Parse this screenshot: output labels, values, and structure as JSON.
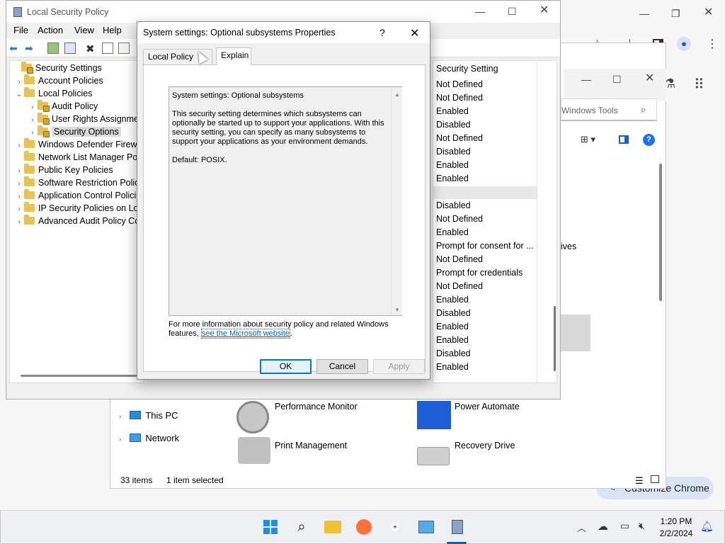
{
  "chrome": {
    "customize_label": "Customize Chrome"
  },
  "explorer": {
    "search_placeholder": "Windows Tools",
    "nav": [
      {
        "label": "This PC",
        "icon": "computer-icon"
      },
      {
        "label": "Network",
        "icon": "network-icon"
      }
    ],
    "items": [
      {
        "label": "Performance Monitor",
        "icon": "gauge-icon"
      },
      {
        "label": "Power Automate",
        "icon": "power-automate-icon"
      },
      {
        "label": "Print Management",
        "icon": "printer-icon"
      },
      {
        "label": "Recovery Drive",
        "icon": "drive-icon"
      }
    ],
    "partial_label": "ives",
    "status": {
      "count": "33 items",
      "selected": "1 item selected"
    }
  },
  "lsp": {
    "title": "Local Security Policy",
    "menu": [
      "File",
      "Action",
      "View",
      "Help"
    ],
    "tree": [
      {
        "label": "Security Settings",
        "level": 0,
        "chev": ""
      },
      {
        "label": "Account Policies",
        "level": 1,
        "chev": "›"
      },
      {
        "label": "Local Policies",
        "level": 1,
        "chev": "⌄"
      },
      {
        "label": "Audit Policy",
        "level": 2,
        "chev": "›"
      },
      {
        "label": "User Rights Assignment",
        "level": 2,
        "chev": "›"
      },
      {
        "label": "Security Options",
        "level": 2,
        "chev": "›",
        "selected": true
      },
      {
        "label": "Windows Defender Firewall",
        "level": 1,
        "chev": "›"
      },
      {
        "label": "Network List Manager Policies",
        "level": 1,
        "chev": ""
      },
      {
        "label": "Public Key Policies",
        "level": 1,
        "chev": "›"
      },
      {
        "label": "Software Restriction Policies",
        "level": 1,
        "chev": "›"
      },
      {
        "label": "Application Control Policies",
        "level": 1,
        "chev": "›"
      },
      {
        "label": "IP Security Policies on Local Computer",
        "level": 1,
        "chev": "›"
      },
      {
        "label": "Advanced Audit Policy Configuration",
        "level": 1,
        "chev": "›"
      }
    ],
    "column_header": "Security Setting",
    "settings": [
      "Not Defined",
      "Not Defined",
      "Enabled",
      "Disabled",
      "Not Defined",
      "Disabled",
      "Enabled",
      "Enabled",
      "",
      "Disabled",
      "Not Defined",
      "Enabled",
      "Prompt for consent for ...",
      "Not Defined",
      "Prompt for credentials",
      "Not Defined",
      "Enabled",
      "Disabled",
      "Enabled",
      "Enabled",
      "Disabled",
      "Enabled"
    ]
  },
  "dialog": {
    "title": "System settings: Optional subsystems Properties",
    "help": "?",
    "close": "✕",
    "tabs": [
      "Local Policy Setting",
      "Explain"
    ],
    "explain_heading": "System settings: Optional subsystems",
    "explain_body": "This security setting determines which subsystems can optionally be started up to support your applications. With this security setting, you can specify as many subsystems to support your applications as your environment demands.",
    "explain_default": "Default: POSIX.",
    "footer_text": "For more information about security policy and related Windows features,",
    "footer_link": "see the Microsoft website",
    "footer_end": ".",
    "buttons": {
      "ok": "OK",
      "cancel": "Cancel",
      "apply": "Apply"
    }
  },
  "taskbar": {
    "time": "1:20 PM",
    "date": "2/2/2024"
  }
}
